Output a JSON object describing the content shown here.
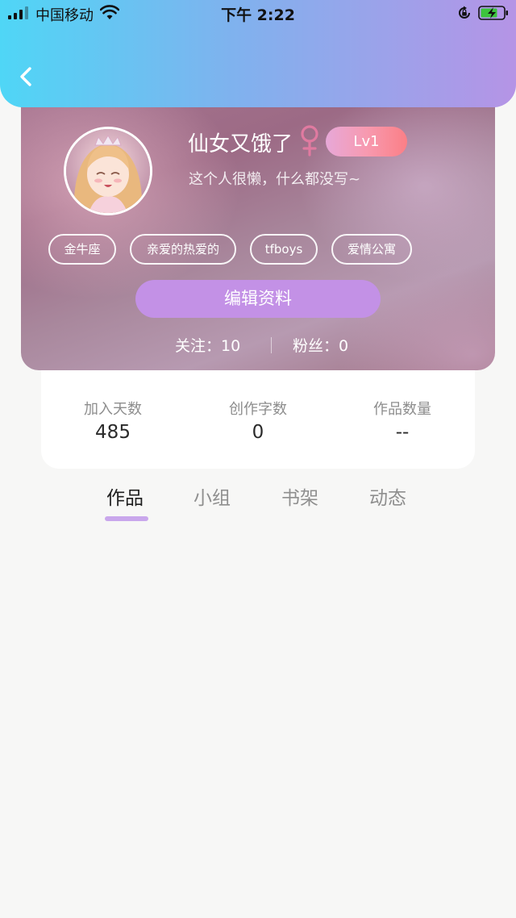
{
  "status_bar": {
    "carrier": "中国移动",
    "time": "下午 2:22"
  },
  "profile": {
    "nickname": "仙女又饿了",
    "level": "Lv1",
    "bio": "这个人很懒，什么都没写~",
    "tags": [
      "金牛座",
      "亲爱的热爱的",
      "tfboys",
      "爱情公寓"
    ],
    "edit_button": "编辑资料",
    "following_label": "关注：",
    "following_count": "10",
    "followers_label": "粉丝：",
    "followers_count": "0"
  },
  "stats": [
    {
      "label": "加入天数",
      "value": "485"
    },
    {
      "label": "创作字数",
      "value": "0"
    },
    {
      "label": "作品数量",
      "value": "--"
    }
  ],
  "tabs": [
    {
      "label": "作品",
      "active": true
    },
    {
      "label": "小组",
      "active": false
    },
    {
      "label": "书架",
      "active": false
    },
    {
      "label": "动态",
      "active": false
    }
  ],
  "colors": {
    "header_gradient_start": "#4fd6f6",
    "header_gradient_end": "#b594e6",
    "edit_button": "#c391e6",
    "level_badge_start": "#e7a8d8",
    "level_badge_end": "#fb7f86",
    "gender_female": "#e07aa0",
    "tab_indicator": "#c9a7ec",
    "page_background": "#f7f7f6"
  },
  "icons": {
    "back": "chevron-left-icon",
    "gender": "female-symbol-icon",
    "signal": "cellular-signal-icon",
    "wifi": "wifi-icon",
    "rotation_lock": "rotation-lock-icon",
    "battery": "battery-charging-icon"
  }
}
